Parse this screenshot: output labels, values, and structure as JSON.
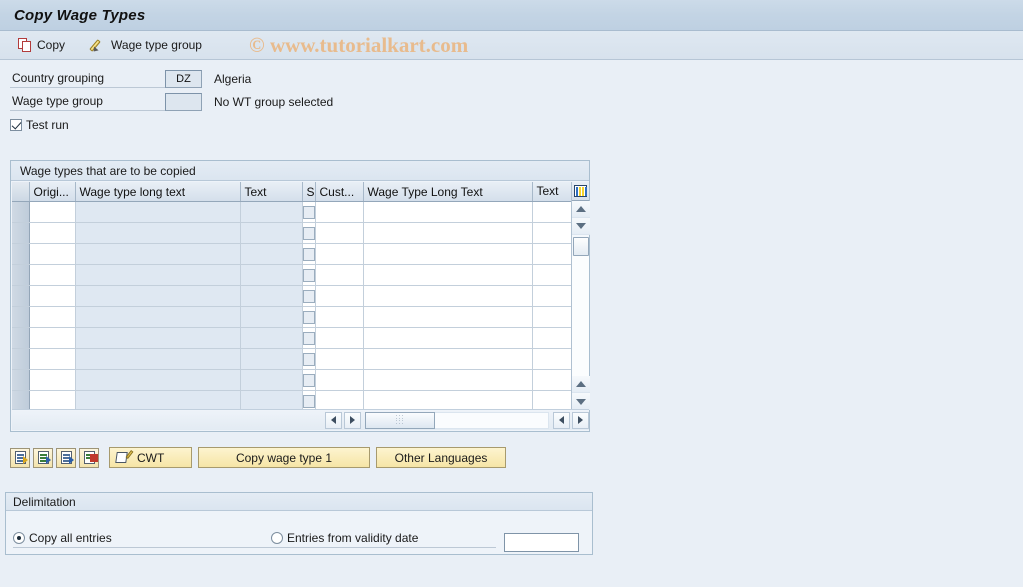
{
  "window": {
    "title": "Copy Wage Types"
  },
  "toolbar": {
    "copy_label": "Copy",
    "wage_type_group_label": "Wage type group"
  },
  "watermark": "© www.tutorialkart.com",
  "selection": {
    "country_grouping_label": "Country grouping",
    "country_grouping_value": "DZ",
    "country_grouping_desc": "Algeria",
    "wage_type_group_label": "Wage type group",
    "wage_type_group_value": "",
    "wage_type_group_desc": "No WT group selected",
    "test_run_label": "Test run",
    "test_run_checked": true
  },
  "grid": {
    "title": "Wage types that are to be copied",
    "columns": [
      {
        "label": "",
        "kind": "selector"
      },
      {
        "label": "Origi...",
        "kind": "input"
      },
      {
        "label": "Wage type long text",
        "kind": "readonly"
      },
      {
        "label": "Text",
        "kind": "readonly"
      },
      {
        "label": "S",
        "kind": "checkbox"
      },
      {
        "label": "Cust...",
        "kind": "input"
      },
      {
        "label": "Wage Type Long Text",
        "kind": "input"
      },
      {
        "label": "Text",
        "kind": "input"
      }
    ],
    "config_icon": "table-settings-icon",
    "row_count": 10,
    "rows": [
      [
        "",
        "",
        "",
        "",
        "",
        "",
        "",
        ""
      ],
      [
        "",
        "",
        "",
        "",
        "",
        "",
        "",
        ""
      ],
      [
        "",
        "",
        "",
        "",
        "",
        "",
        "",
        ""
      ],
      [
        "",
        "",
        "",
        "",
        "",
        "",
        "",
        ""
      ],
      [
        "",
        "",
        "",
        "",
        "",
        "",
        "",
        ""
      ],
      [
        "",
        "",
        "",
        "",
        "",
        "",
        "",
        ""
      ],
      [
        "",
        "",
        "",
        "",
        "",
        "",
        "",
        ""
      ],
      [
        "",
        "",
        "",
        "",
        "",
        "",
        "",
        ""
      ],
      [
        "",
        "",
        "",
        "",
        "",
        "",
        "",
        ""
      ],
      [
        "",
        "",
        "",
        "",
        "",
        "",
        "",
        ""
      ]
    ]
  },
  "actions": {
    "icon_buttons": [
      {
        "name": "select-all-entries-icon",
        "title": ""
      },
      {
        "name": "copy-list-icon",
        "title": ""
      },
      {
        "name": "detail-list-icon",
        "title": ""
      },
      {
        "name": "delete-entry-icon",
        "title": ""
      }
    ],
    "cwt_label": "CWT",
    "copy_wage_type_label": "Copy wage type 1",
    "other_languages_label": "Other Languages"
  },
  "delimitation": {
    "title": "Delimitation",
    "copy_all_label": "Copy all entries",
    "copy_all_selected": true,
    "validity_label": "Entries from validity date",
    "validity_selected": false,
    "validity_date_value": "",
    "validity_date_placeholder": ""
  },
  "colors": {
    "page_background": "#e9eff6",
    "titlebar": "#c5d5e5",
    "button_yellow": "#f6e5a6",
    "readonly_cell": "#dfe8f2",
    "watermark": "#e8bb8d"
  }
}
